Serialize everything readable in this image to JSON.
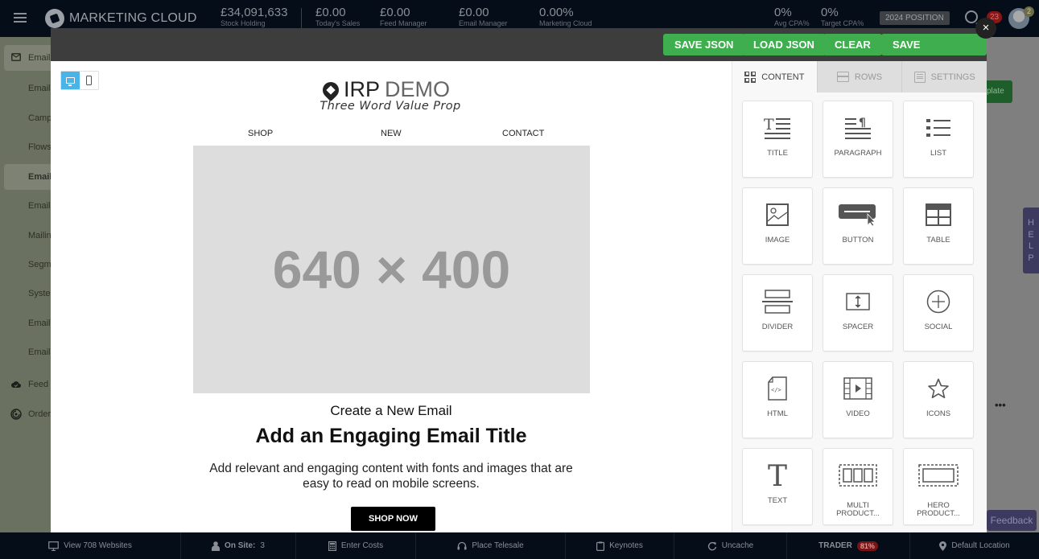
{
  "topbar": {
    "brand": "MARKETING CLOUD",
    "stats": [
      {
        "value": "£34,091,633",
        "label": "Stock Holding"
      },
      {
        "value": "£0.00",
        "label": "Today's Sales"
      },
      {
        "value": "£0.00",
        "label": "Feed Manager"
      },
      {
        "value": "£0.00",
        "label": "Email Manager"
      },
      {
        "value": "0.00%",
        "label": "Marketing Cloud"
      },
      {
        "value": "0%",
        "label": "Avg CPA%"
      },
      {
        "value": "0%",
        "label": "Target CPA%"
      }
    ],
    "position_button": "2024 POSITION",
    "notification_count": "23",
    "avatar_badge": "2"
  },
  "sidenav": {
    "items": [
      {
        "label": "Email",
        "icon": "envelope-icon",
        "active": true
      },
      {
        "label": "Email",
        "icon": ""
      },
      {
        "label": "Camp",
        "icon": ""
      },
      {
        "label": "Flows",
        "icon": ""
      },
      {
        "label": "Email",
        "icon": "",
        "active": true,
        "bold": true
      },
      {
        "label": "Email",
        "icon": ""
      },
      {
        "label": "Mailin",
        "icon": ""
      },
      {
        "label": "Segm",
        "icon": ""
      },
      {
        "label": "Syster",
        "icon": ""
      },
      {
        "label": "Email",
        "icon": ""
      },
      {
        "label": "Email",
        "icon": ""
      },
      {
        "label": "Feed M",
        "icon": "cloud-check-icon"
      },
      {
        "label": "Order",
        "icon": "radar-icon"
      }
    ]
  },
  "modal": {
    "buttons": {
      "save_json": "SAVE JSON",
      "load_json": "LOAD JSON",
      "clear": "CLEAR",
      "save_template": "SAVE TEMPLATE"
    },
    "close": "×",
    "device_toggle": {
      "desktop": "desktop-icon",
      "mobile": "mobile-icon",
      "selected": "desktop"
    }
  },
  "email": {
    "logo_bold": "IRP",
    "logo_light": "DEMO",
    "tagline": "Three Word Value Prop",
    "nav": [
      "SHOP",
      "NEW",
      "CONTACT"
    ],
    "hero_placeholder": "640 × 400",
    "pretitle": "Create a New Email",
    "title": "Add an Engaging Email Title",
    "body": "Add relevant and engaging content with fonts and images that are easy to read on mobile screens.",
    "cta": "SHOP NOW"
  },
  "sidebar": {
    "tabs": [
      {
        "label": "CONTENT",
        "icon": "grid-icon",
        "active": true
      },
      {
        "label": "ROWS",
        "icon": "rows-icon"
      },
      {
        "label": "SETTINGS",
        "icon": "settings-icon"
      }
    ],
    "blocks": [
      {
        "label": "TITLE",
        "icon": "title-icon"
      },
      {
        "label": "PARAGRAPH",
        "icon": "paragraph-icon"
      },
      {
        "label": "LIST",
        "icon": "list-icon"
      },
      {
        "label": "IMAGE",
        "icon": "image-icon"
      },
      {
        "label": "BUTTON",
        "icon": "button-icon"
      },
      {
        "label": "TABLE",
        "icon": "table-icon"
      },
      {
        "label": "DIVIDER",
        "icon": "divider-icon"
      },
      {
        "label": "SPACER",
        "icon": "spacer-icon"
      },
      {
        "label": "SOCIAL",
        "icon": "social-icon"
      },
      {
        "label": "HTML",
        "icon": "html-icon"
      },
      {
        "label": "VIDEO",
        "icon": "video-icon"
      },
      {
        "label": "ICONS",
        "icon": "star-icon"
      },
      {
        "label": "TEXT",
        "icon": "text-icon"
      },
      {
        "label": "MULTI PRODUCT...",
        "line1": "MULTI",
        "line2": "PRODUCT...",
        "icon": "multi-product-icon"
      },
      {
        "label": "HERO PRODUCT...",
        "line1": "HERO",
        "line2": "PRODUCT...",
        "icon": "hero-product-icon"
      }
    ]
  },
  "background": {
    "green_button_fragment": "plate",
    "help_tab": [
      "H",
      "E",
      "L",
      "P"
    ],
    "feedback": "Feedback",
    "more": "•••"
  },
  "bottombar": {
    "items": [
      {
        "label": "View 708 Websites",
        "icon": "monitor-icon"
      },
      {
        "label": "On Site:",
        "value": "3",
        "icon": "user-icon"
      },
      {
        "label": "Enter Costs",
        "icon": "calculator-icon"
      },
      {
        "label": "Place Telesale",
        "icon": "headset-icon"
      },
      {
        "label": "Keynotes",
        "icon": "clipboard-icon"
      },
      {
        "label": "Uncache",
        "icon": "refresh-icon"
      },
      {
        "label": "TRADER",
        "badge": "81%"
      },
      {
        "label": "Default Location",
        "icon": "map-pin-icon"
      }
    ]
  },
  "colors": {
    "accent_green": "#3fae4e",
    "device_active": "#4ab3e8",
    "badge_red": "#8b1616",
    "help_purple": "#3c3a5e"
  }
}
